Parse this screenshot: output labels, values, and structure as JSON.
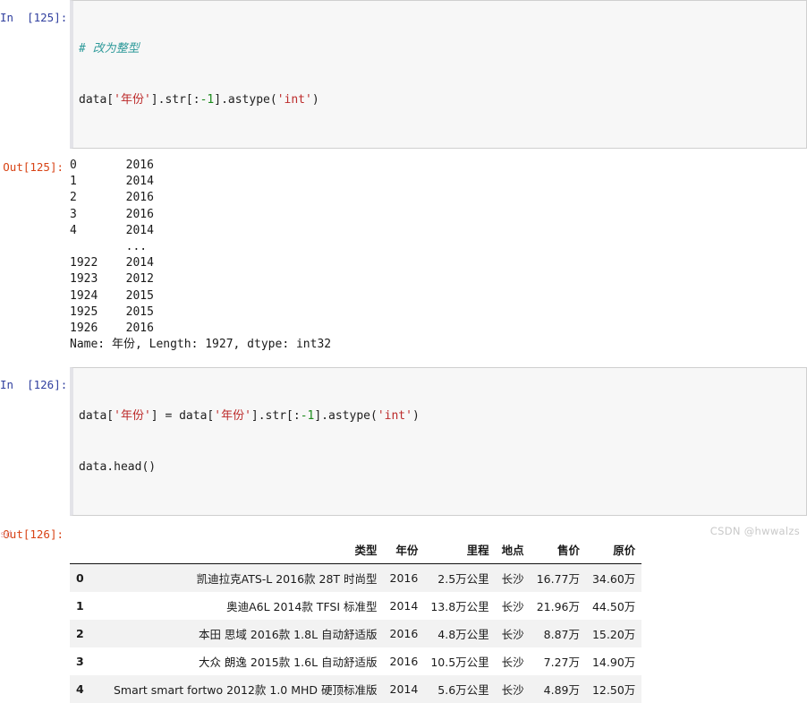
{
  "cells": [
    {
      "type": "input",
      "prompt": "In  [125]:",
      "lines": [
        {
          "segments": [
            {
              "text": "# 改为整型",
              "cls": "tok-comment"
            }
          ]
        },
        {
          "segments": [
            {
              "text": "data[",
              "cls": "tok-op"
            },
            {
              "text": "'年份'",
              "cls": "tok-str"
            },
            {
              "text": "].str[:",
              "cls": "tok-op"
            },
            {
              "text": "-1",
              "cls": "tok-num"
            },
            {
              "text": "].astype(",
              "cls": "tok-op"
            },
            {
              "text": "'int'",
              "cls": "tok-str"
            },
            {
              "text": ")",
              "cls": "tok-op"
            }
          ]
        }
      ]
    },
    {
      "type": "output-text",
      "prompt": "Out[125]:",
      "text": "0       2016\n1       2014\n2       2016\n3       2016\n4       2014\n        ... \n1922    2014\n1923    2012\n1924    2015\n1925    2015\n1926    2016\nName: 年份, Length: 1927, dtype: int32"
    },
    {
      "type": "input",
      "prompt": "In  [126]:",
      "lines": [
        {
          "segments": [
            {
              "text": "data[",
              "cls": "tok-op"
            },
            {
              "text": "'年份'",
              "cls": "tok-str"
            },
            {
              "text": "] = data[",
              "cls": "tok-op"
            },
            {
              "text": "'年份'",
              "cls": "tok-str"
            },
            {
              "text": "].str[:",
              "cls": "tok-op"
            },
            {
              "text": "-1",
              "cls": "tok-num"
            },
            {
              "text": "].astype(",
              "cls": "tok-op"
            },
            {
              "text": "'int'",
              "cls": "tok-str"
            },
            {
              "text": ")",
              "cls": "tok-op"
            }
          ]
        },
        {
          "segments": [
            {
              "text": "data.head()",
              "cls": "tok-op"
            }
          ]
        }
      ]
    },
    {
      "type": "output-df",
      "prompt": "Out[126]:"
    }
  ],
  "dataframe": {
    "index_header": "",
    "columns": [
      "类型",
      "年份",
      "里程",
      "地点",
      "售价",
      "原价"
    ],
    "rows": [
      {
        "index": "0",
        "cells": [
          "凯迪拉克ATS-L 2016款 28T 时尚型",
          "2016",
          "2.5万公里",
          "长沙",
          "16.77万",
          "34.60万"
        ]
      },
      {
        "index": "1",
        "cells": [
          "奥迪A6L 2014款 TFSI 标准型",
          "2014",
          "13.8万公里",
          "长沙",
          "21.96万",
          "44.50万"
        ]
      },
      {
        "index": "2",
        "cells": [
          "本田 思域 2016款 1.8L 自动舒适版",
          "2016",
          "4.8万公里",
          "长沙",
          "8.87万",
          "15.20万"
        ]
      },
      {
        "index": "3",
        "cells": [
          "大众 朗逸 2015款 1.6L 自动舒适版",
          "2016",
          "10.5万公里",
          "长沙",
          "7.27万",
          "14.90万"
        ]
      },
      {
        "index": "4",
        "cells": [
          "Smart smart fortwo 2012款 1.0 MHD 硬顶标准版",
          "2014",
          "5.6万公里",
          "长沙",
          "4.89万",
          "12.50万"
        ]
      }
    ]
  },
  "artifacts": {
    "watermark": "CSDN @hwwalzs",
    "edge_fragment": "sd"
  },
  "colors": {
    "in_prompt": "#303f9f",
    "out_prompt": "#d84315",
    "comment": "#2e9a9a",
    "string": "#bc2a2a",
    "number": "#1a8a1a",
    "input_bg": "#f7f7f7",
    "stripe_bg": "#f2f2f2"
  }
}
